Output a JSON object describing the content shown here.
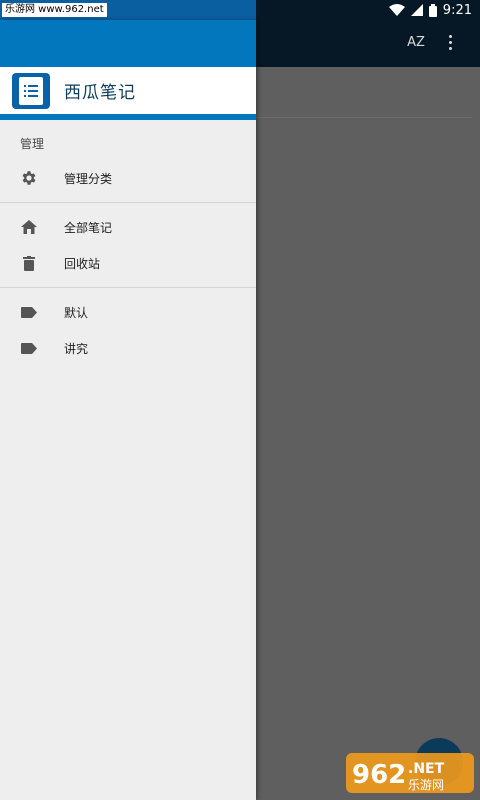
{
  "status_bar": {
    "watermark_text": "乐游网 www.962.net",
    "time": "9:21"
  },
  "app_bar": {
    "sort_icon_text": "AZ"
  },
  "drawer": {
    "app_title": "西瓜笔记",
    "section_manage_label": "管理",
    "items": [
      {
        "label": "管理分类",
        "icon": "gear-icon"
      },
      {
        "label": "全部笔记",
        "icon": "home-icon"
      },
      {
        "label": "回收站",
        "icon": "trash-icon"
      },
      {
        "label": "默认",
        "icon": "tag-icon"
      },
      {
        "label": "讲究",
        "icon": "tag-icon"
      }
    ]
  },
  "watermark": {
    "brand_number": "962",
    "brand_suffix": ".NET",
    "brand_cn": "乐游网"
  },
  "colors": {
    "header_blue": "#0277bd",
    "dark_bar": "#061826",
    "scrim": "#5f5f5f",
    "drawer_bg": "#eeeeee"
  }
}
